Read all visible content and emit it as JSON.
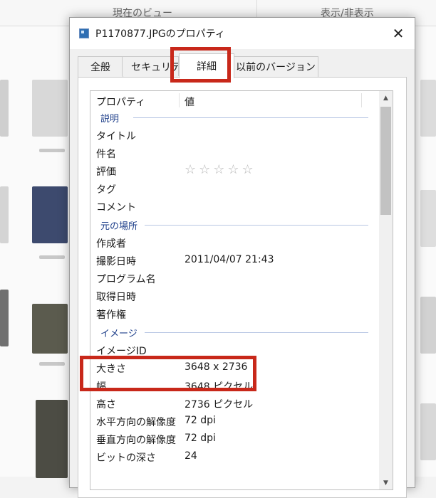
{
  "ribbon": {
    "group1_label": "現在のビュー",
    "group2_label": "表示/非表示"
  },
  "dialog": {
    "title": "P1170877.JPGのプロパティ",
    "close_glyph": "✕",
    "tabs": [
      {
        "label": "全般"
      },
      {
        "label": "セキュリティ"
      },
      {
        "label": "詳細"
      },
      {
        "label": "以前のバージョン"
      }
    ],
    "active_tab": "詳細"
  },
  "properties": {
    "header": {
      "name": "プロパティ",
      "value": "値"
    },
    "groups": {
      "description": "説明",
      "origin": "元の場所",
      "image": "イメージ"
    },
    "rows": {
      "title": {
        "name": "タイトル",
        "value": ""
      },
      "subject": {
        "name": "件名",
        "value": ""
      },
      "rating": {
        "name": "評価",
        "value": "☆☆☆☆☆",
        "stars_filled": 0,
        "stars_total": 5
      },
      "tags": {
        "name": "タグ",
        "value": ""
      },
      "comment": {
        "name": "コメント",
        "value": ""
      },
      "author": {
        "name": "作成者",
        "value": ""
      },
      "date_taken": {
        "name": "撮影日時",
        "value": "2011/04/07 21:43"
      },
      "program": {
        "name": "プログラム名",
        "value": ""
      },
      "date_acquired": {
        "name": "取得日時",
        "value": ""
      },
      "copyright": {
        "name": "著作権",
        "value": ""
      },
      "image_id": {
        "name": "イメージID",
        "value": ""
      },
      "dimensions": {
        "name": "大きさ",
        "value": "3648 x 2736"
      },
      "width": {
        "name": "幅",
        "value": "3648 ピクセル"
      },
      "height": {
        "name": "高さ",
        "value": "2736 ピクセル"
      },
      "h_resolution": {
        "name": "水平方向の解像度",
        "value": "72 dpi"
      },
      "v_resolution": {
        "name": "垂直方向の解像度",
        "value": "72 dpi"
      },
      "bit_depth": {
        "name": "ビットの深さ",
        "value": "24"
      }
    }
  },
  "scrollbar": {
    "up_glyph": "▲",
    "down_glyph": "▼"
  },
  "colors": {
    "highlight": "#c8281a",
    "group_heading": "#1e3f8a"
  }
}
